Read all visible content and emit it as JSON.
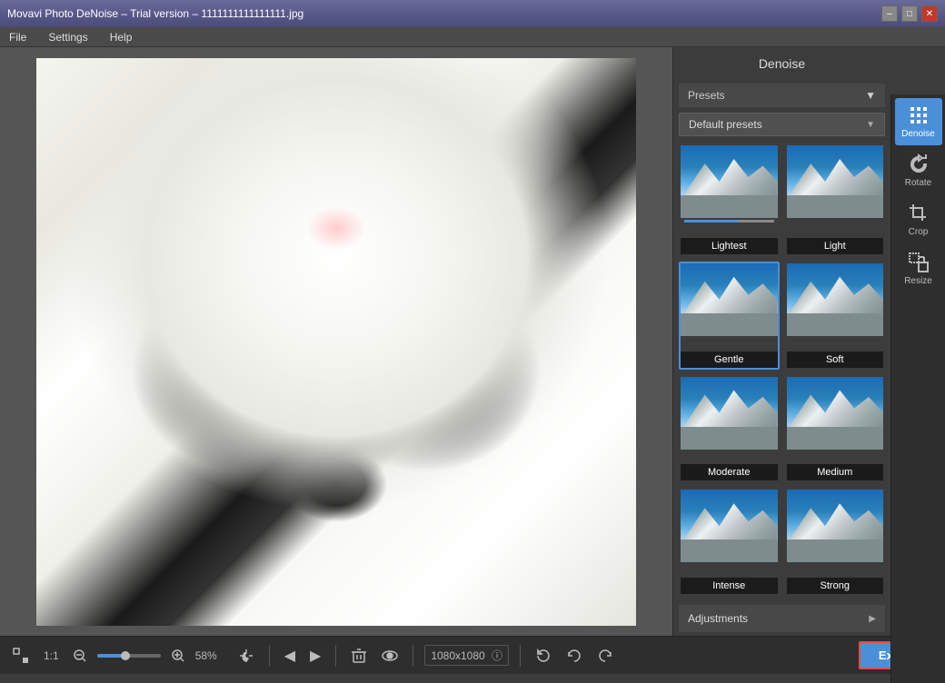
{
  "titlebar": {
    "title": "Movavi Photo DeNoise – Trial version – 1111111111111111.jpg",
    "min_label": "–",
    "max_label": "□",
    "close_label": "✕"
  },
  "menubar": {
    "items": [
      "File",
      "Settings",
      "Help"
    ]
  },
  "right_panel": {
    "title": "Denoise",
    "presets_label": "Presets",
    "default_presets_label": "Default presets",
    "adjustments_label": "Adjustments",
    "presets": [
      {
        "id": "lightest",
        "label": "Lightest",
        "selected": false
      },
      {
        "id": "light",
        "label": "Light",
        "selected": false
      },
      {
        "id": "gentle",
        "label": "Gentle",
        "selected": true
      },
      {
        "id": "soft",
        "label": "Soft",
        "selected": false
      },
      {
        "id": "moderate",
        "label": "Moderate",
        "selected": false
      },
      {
        "id": "medium",
        "label": "Medium",
        "selected": false
      },
      {
        "id": "intense",
        "label": "Intense",
        "selected": false
      },
      {
        "id": "strong",
        "label": "Strong",
        "selected": false
      }
    ]
  },
  "tools": [
    {
      "id": "denoise",
      "label": "Denoise",
      "active": true
    },
    {
      "id": "rotate",
      "label": "Rotate",
      "active": false
    },
    {
      "id": "crop",
      "label": "Crop",
      "active": false
    },
    {
      "id": "resize",
      "label": "Resize",
      "active": false
    }
  ],
  "bottom_toolbar": {
    "zoom_label_11": "1:1",
    "zoom_percent": "58%",
    "image_size": "1080x1080",
    "export_label": "Export"
  }
}
